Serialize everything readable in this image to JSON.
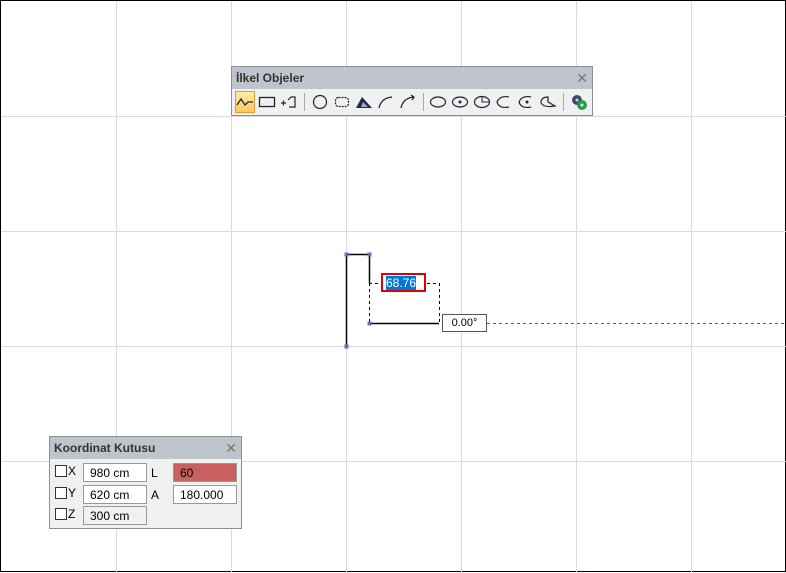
{
  "toolbar": {
    "title": "İlkel Objeler",
    "close": "✕",
    "tools": [
      "polyline-icon",
      "rectangle-icon",
      "add-line-icon",
      "circle-icon",
      "cloud-icon",
      "wedge-icon",
      "arc-icon",
      "arc-arrow-icon",
      "ellipse-icon",
      "ellipse-center-icon",
      "pie-icon",
      "ellipse-arc-icon",
      "ellipse-arc-center-icon",
      "ellipse-pie-icon",
      "settings-gears-icon"
    ]
  },
  "drawing": {
    "length_input": "68.76",
    "angle_label": "0.00°",
    "colors": {
      "input_border": "#e00000",
      "selection": "#0078d7",
      "guide": "#00a000"
    }
  },
  "coord": {
    "title": "Koordinat Kutusu",
    "close": "✕",
    "x_label": "X",
    "x_value": "980 cm",
    "y_label": "Y",
    "y_value": "620 cm",
    "z_label": "Z",
    "z_value": "300 cm",
    "l_label": "L",
    "l_value": "60",
    "a_label": "A",
    "a_value": "180.000",
    "l_color": "#c86060"
  }
}
